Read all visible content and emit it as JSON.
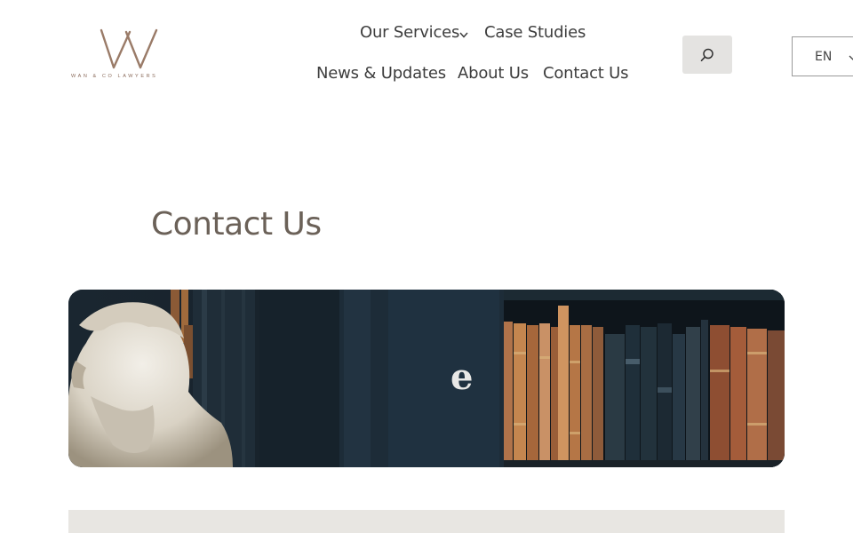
{
  "logo": {
    "name": "WAN & CO LAWYERS"
  },
  "nav": {
    "services": "Our Services",
    "case_studies": "Case Studies",
    "news": "News & Updates",
    "about": "About Us",
    "contact": "Contact Us"
  },
  "language": {
    "current": "EN"
  },
  "page": {
    "title": "Contact Us"
  },
  "hero": {
    "book_spine_letter": "e"
  },
  "icons": {
    "search": "search-icon",
    "services_dropdown": "chevron-down-icon",
    "language_dropdown": "chevron-down-icon",
    "logo": "w-monogram-logo"
  },
  "colors": {
    "brand_brown": "#9a7b68",
    "text": "#3d3d3d",
    "title": "#6b6158",
    "search_bg": "#e4e3e1",
    "band": "#e8e6e2"
  }
}
